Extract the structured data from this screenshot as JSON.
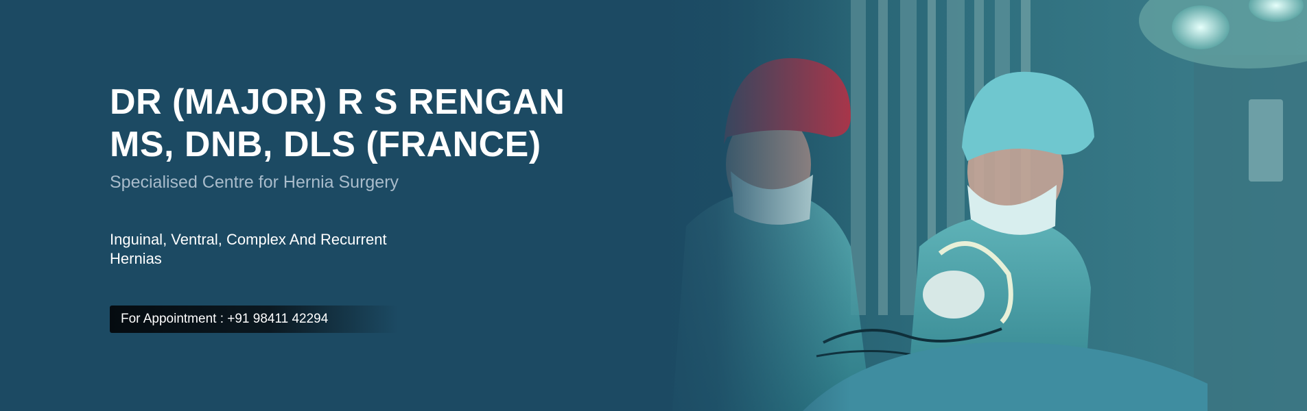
{
  "hero": {
    "title_line1": "DR (MAJOR) R S RENGAN",
    "title_line2": "MS, DNB, DLS (FRANCE)",
    "subtitle": "Specialised Centre for Hernia Surgery",
    "services": "Inguinal, Ventral, Complex And Recurrent Hernias",
    "appointment_label": "For Appointment : +91 98411 42294"
  },
  "colors": {
    "background": "#1c4a63",
    "text": "#ffffff",
    "subtitle": "#a9bccb",
    "button": "#050b10"
  },
  "icons": {
    "photo": "surgeons-operating-photo"
  }
}
